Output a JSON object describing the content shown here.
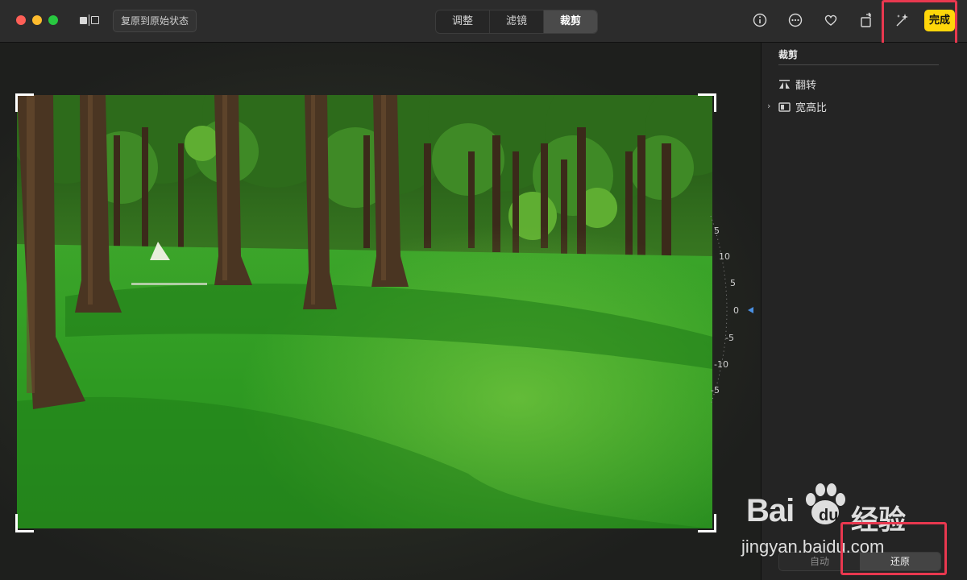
{
  "toolbar": {
    "revert_to_original": "复原到原始状态",
    "tabs": [
      {
        "label": "调整",
        "active": false
      },
      {
        "label": "滤镜",
        "active": false
      },
      {
        "label": "裁剪",
        "active": true
      }
    ],
    "icons": [
      "info-icon",
      "more-icon",
      "heart-icon",
      "rotate-icon",
      "magic-wand-icon"
    ],
    "done_label": "完成",
    "done_color": "#ffd60a"
  },
  "dial": {
    "ticks": [
      "5",
      "10",
      "5",
      "0",
      "-5",
      "-10",
      "-5"
    ],
    "current": "0"
  },
  "sidebar": {
    "title": "裁剪",
    "items": [
      {
        "label": "翻转",
        "icon": "flip-icon"
      },
      {
        "label": "宽高比",
        "icon": "aspect-ratio-icon"
      }
    ],
    "bottom": {
      "auto_label": "自动",
      "revert_label": "还原"
    }
  },
  "watermark": {
    "brand": "Bai",
    "brand_cn": "经验",
    "url": "jingyan.baidu.com"
  },
  "accent_color": "#e8384f"
}
